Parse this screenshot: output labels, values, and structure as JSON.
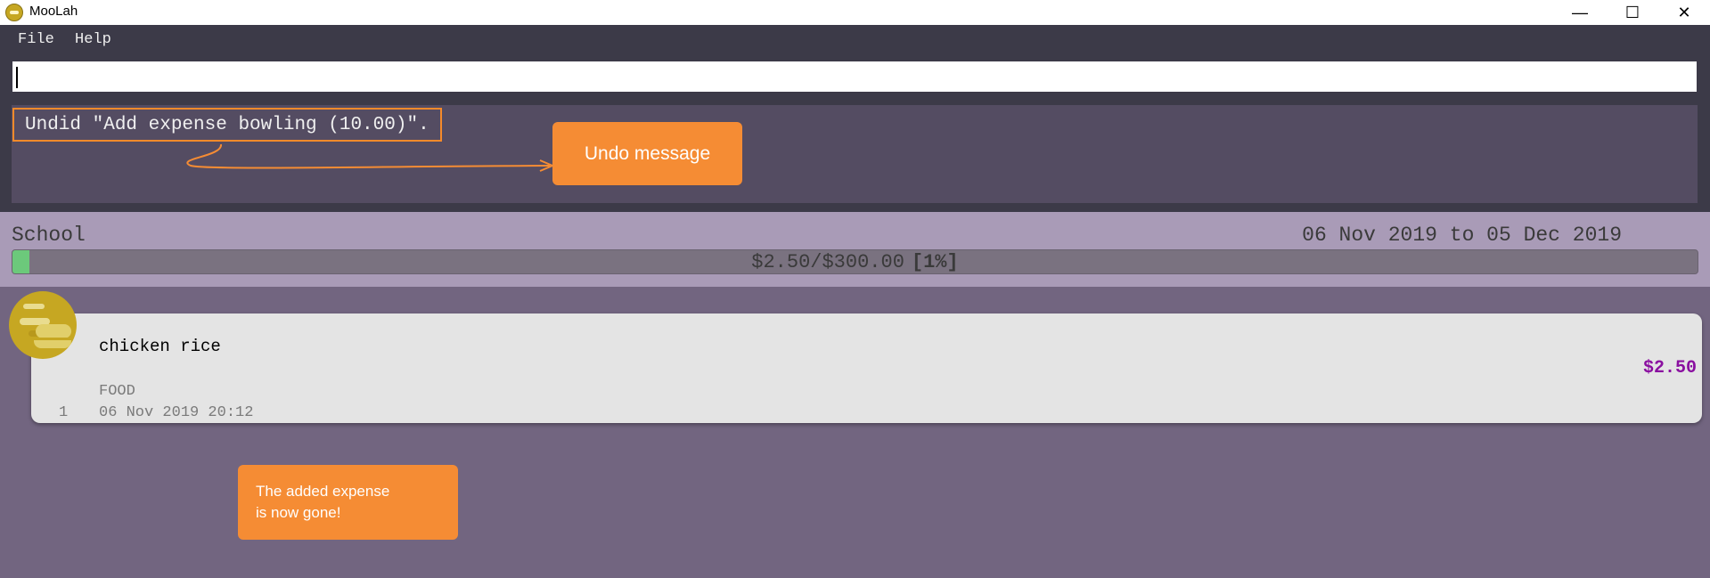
{
  "window": {
    "title": "MooLah",
    "minimize_glyph": "—",
    "maximize_glyph": "☐",
    "close_glyph": "✕"
  },
  "menu": {
    "items": [
      "File",
      "Help"
    ]
  },
  "command_box": {
    "value": "",
    "placeholder": ""
  },
  "result_display": {
    "text": "Undid \"Add expense bowling (10.00)\"."
  },
  "annotations": {
    "undo_callout": "Undo message",
    "gone_callout": "The added expense\nis now gone!"
  },
  "budget": {
    "name": "School",
    "period": "06 Nov 2019 to 05 Dec 2019",
    "spent_text": "$2.50/$300.00",
    "percent_text": "[1%]",
    "progress_fraction": 0.01
  },
  "expenses": [
    {
      "index": "1",
      "description": "chicken rice",
      "category": "FOOD",
      "date": "06 Nov 2019 20:12",
      "price": "$2.50",
      "icon": "food-icon"
    }
  ],
  "colors": {
    "accent_orange": "#f58c34",
    "progress_green": "#6cc97b",
    "price_purple": "#8a0fa0",
    "food_icon_gold": "#c6a722"
  }
}
